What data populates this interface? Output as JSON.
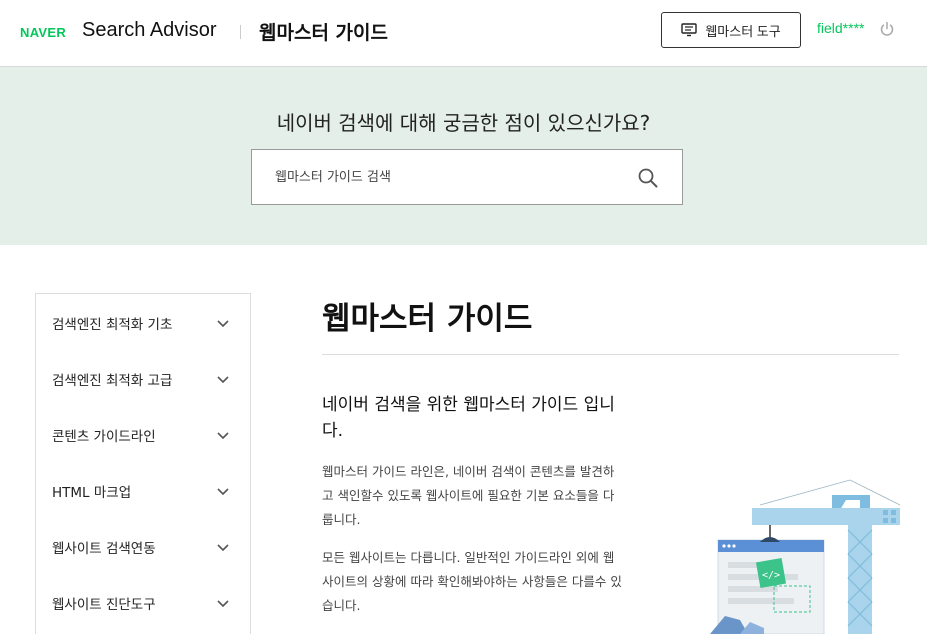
{
  "header": {
    "logo": "NAVER",
    "brand": "Search Advisor",
    "title": "웹마스터 가이드",
    "tool_button": "웹마스터 도구",
    "user_id": "field****"
  },
  "hero": {
    "question": "네이버 검색에 대해 궁금한 점이 있으신가요?",
    "search_placeholder": "웹마스터 가이드 검색"
  },
  "sidebar": {
    "items": [
      {
        "label": "검색엔진 최적화 기초"
      },
      {
        "label": "검색엔진 최적화 고급"
      },
      {
        "label": "콘텐츠 가이드라인"
      },
      {
        "label": "HTML 마크업"
      },
      {
        "label": "웹사이트 검색연동"
      },
      {
        "label": "웹사이트 진단도구"
      }
    ]
  },
  "main": {
    "title": "웹마스터 가이드",
    "lead": "네이버 검색을 위한 웹마스터 가이드 입니다.",
    "paragraph1": "웹마스터 가이드 라인은, 네이버 검색이 콘텐츠를 발견하고 색인할수 있도록 웹사이트에 필요한 기본 요소들을 다룹니다.",
    "paragraph2": "모든 웹사이트는 다릅니다. 일반적인 가이드라인 외에 웹사이트의 상황에 따라 확인해봐야하는 사항들은 다를수 있습니다."
  },
  "icons": {
    "tool": "monitor-icon",
    "power": "power-icon",
    "search": "search-icon",
    "chevron": "chevron-down-icon"
  },
  "colors": {
    "brand_green": "#03c75a",
    "hero_bg": "#e5efe9",
    "crane_blue": "#a9d4ec"
  }
}
